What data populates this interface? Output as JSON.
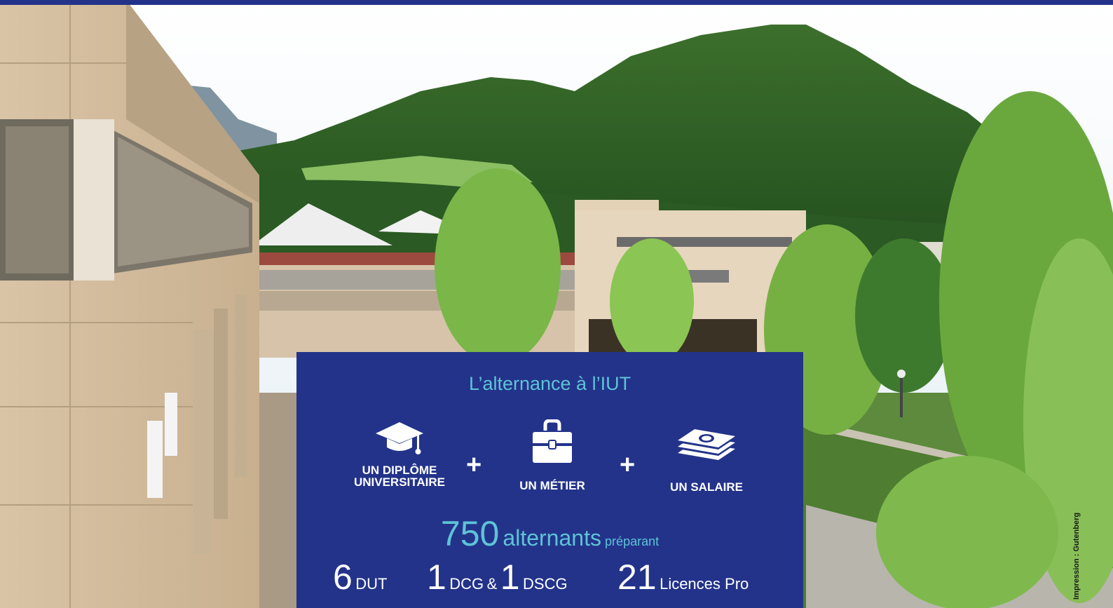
{
  "panel": {
    "title": "L’alternance à l’IUT",
    "features": [
      {
        "icon": "graduation-cap-icon",
        "label_line1": "UN DIPLÔME",
        "label_line2": "UNIVERSITAIRE"
      },
      {
        "icon": "briefcase-icon",
        "label": "UN MÉTIER"
      },
      {
        "icon": "money-stack-icon",
        "label": "UN SALAIRE"
      }
    ],
    "plus_sign": "+",
    "count": "750",
    "count_label": "alternants",
    "count_suffix": "préparant",
    "programs": {
      "dut_count": "6",
      "dut_label": "DUT",
      "dcg_count": "1",
      "dcg_label": "DCG",
      "and_sign": "&",
      "dscg_count": "1",
      "dscg_label": "DSCG",
      "lp_count": "21",
      "lp_label": "Licences Pro"
    }
  },
  "credit": "Impression : Gutenberg",
  "colors": {
    "panel_blue": "#23338a",
    "accent_cyan": "#5ec3d6",
    "text_white": "#ffffff"
  }
}
